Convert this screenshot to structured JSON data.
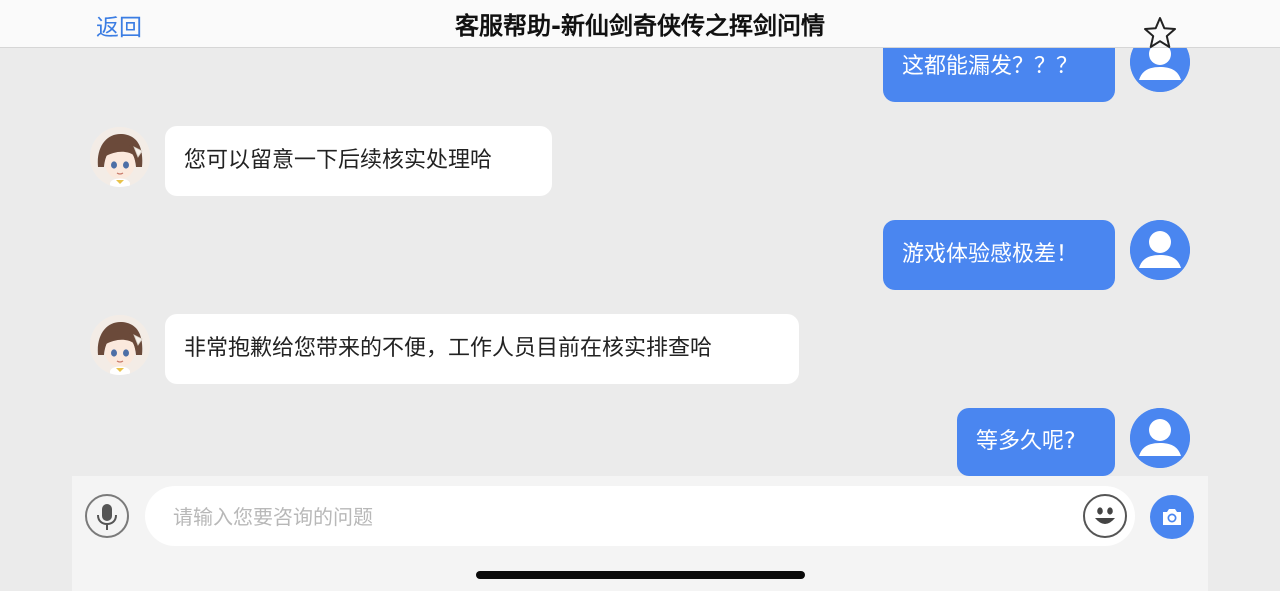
{
  "header": {
    "back_label": "返回",
    "title": "客服帮助-新仙剑奇侠传之挥剑问情",
    "favorite_icon": "star-outline-icon"
  },
  "messages": [
    {
      "sender": "user",
      "text": "这都能漏发？？？"
    },
    {
      "sender": "agent",
      "text": "您可以留意一下后续核实处理哈"
    },
    {
      "sender": "user",
      "text": "游戏体验感极差！"
    },
    {
      "sender": "agent",
      "text": "非常抱歉给您带来的不便，工作人员目前在核实排查哈"
    },
    {
      "sender": "user",
      "text": "等多久呢?"
    }
  ],
  "input": {
    "placeholder": "请输入您要咨询的问题",
    "value": "",
    "mic_icon": "microphone-icon",
    "emoji_icon": "smiley-face-icon",
    "camera_icon": "camera-icon"
  },
  "colors": {
    "accent": "#4a86f0",
    "back_link": "#3b7de3",
    "background": "#ebebeb",
    "agent_bubble": "#ffffff"
  }
}
